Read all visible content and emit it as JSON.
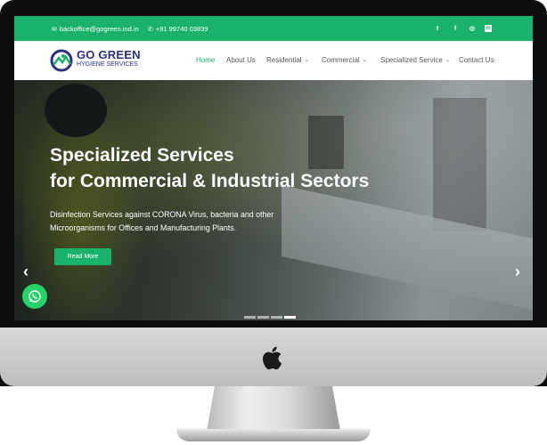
{
  "topbar": {
    "email": "backoffice@gogreen.ind.in",
    "phone": "+91 99740 03839",
    "social": [
      {
        "icon": "twitter-icon",
        "glyph": "t"
      },
      {
        "icon": "facebook-icon",
        "glyph": "f"
      },
      {
        "icon": "instagram-icon",
        "glyph": "◎"
      },
      {
        "icon": "linkedin-icon",
        "glyph": "in"
      }
    ]
  },
  "logo": {
    "name": "GO GREEN",
    "tagline": "HYGIENE SERVICES"
  },
  "nav": {
    "items": [
      {
        "label": "Home",
        "dropdown": false,
        "active": true
      },
      {
        "label": "About Us",
        "dropdown": false,
        "active": false
      },
      {
        "label": "Residential",
        "dropdown": true,
        "active": false
      },
      {
        "label": "Commercial",
        "dropdown": true,
        "active": false
      },
      {
        "label": "Specialized Service",
        "dropdown": true,
        "active": false
      },
      {
        "label": "Contact Us",
        "dropdown": false,
        "active": false
      }
    ]
  },
  "hero": {
    "title_line1": "Specialized Services",
    "title_line2": "for Commercial & Industrial Sectors",
    "subtitle_line1": "Disinfection Services against CORONA Virus, bacteria and other",
    "subtitle_line2": "Microorganisms for Offices and Manufacturing Plants.",
    "button": "Read More",
    "slides": 4,
    "active_slide": 4
  },
  "colors": {
    "brand_green": "#1ab16b",
    "brand_blue": "#2a3180",
    "whatsapp": "#25d366"
  }
}
